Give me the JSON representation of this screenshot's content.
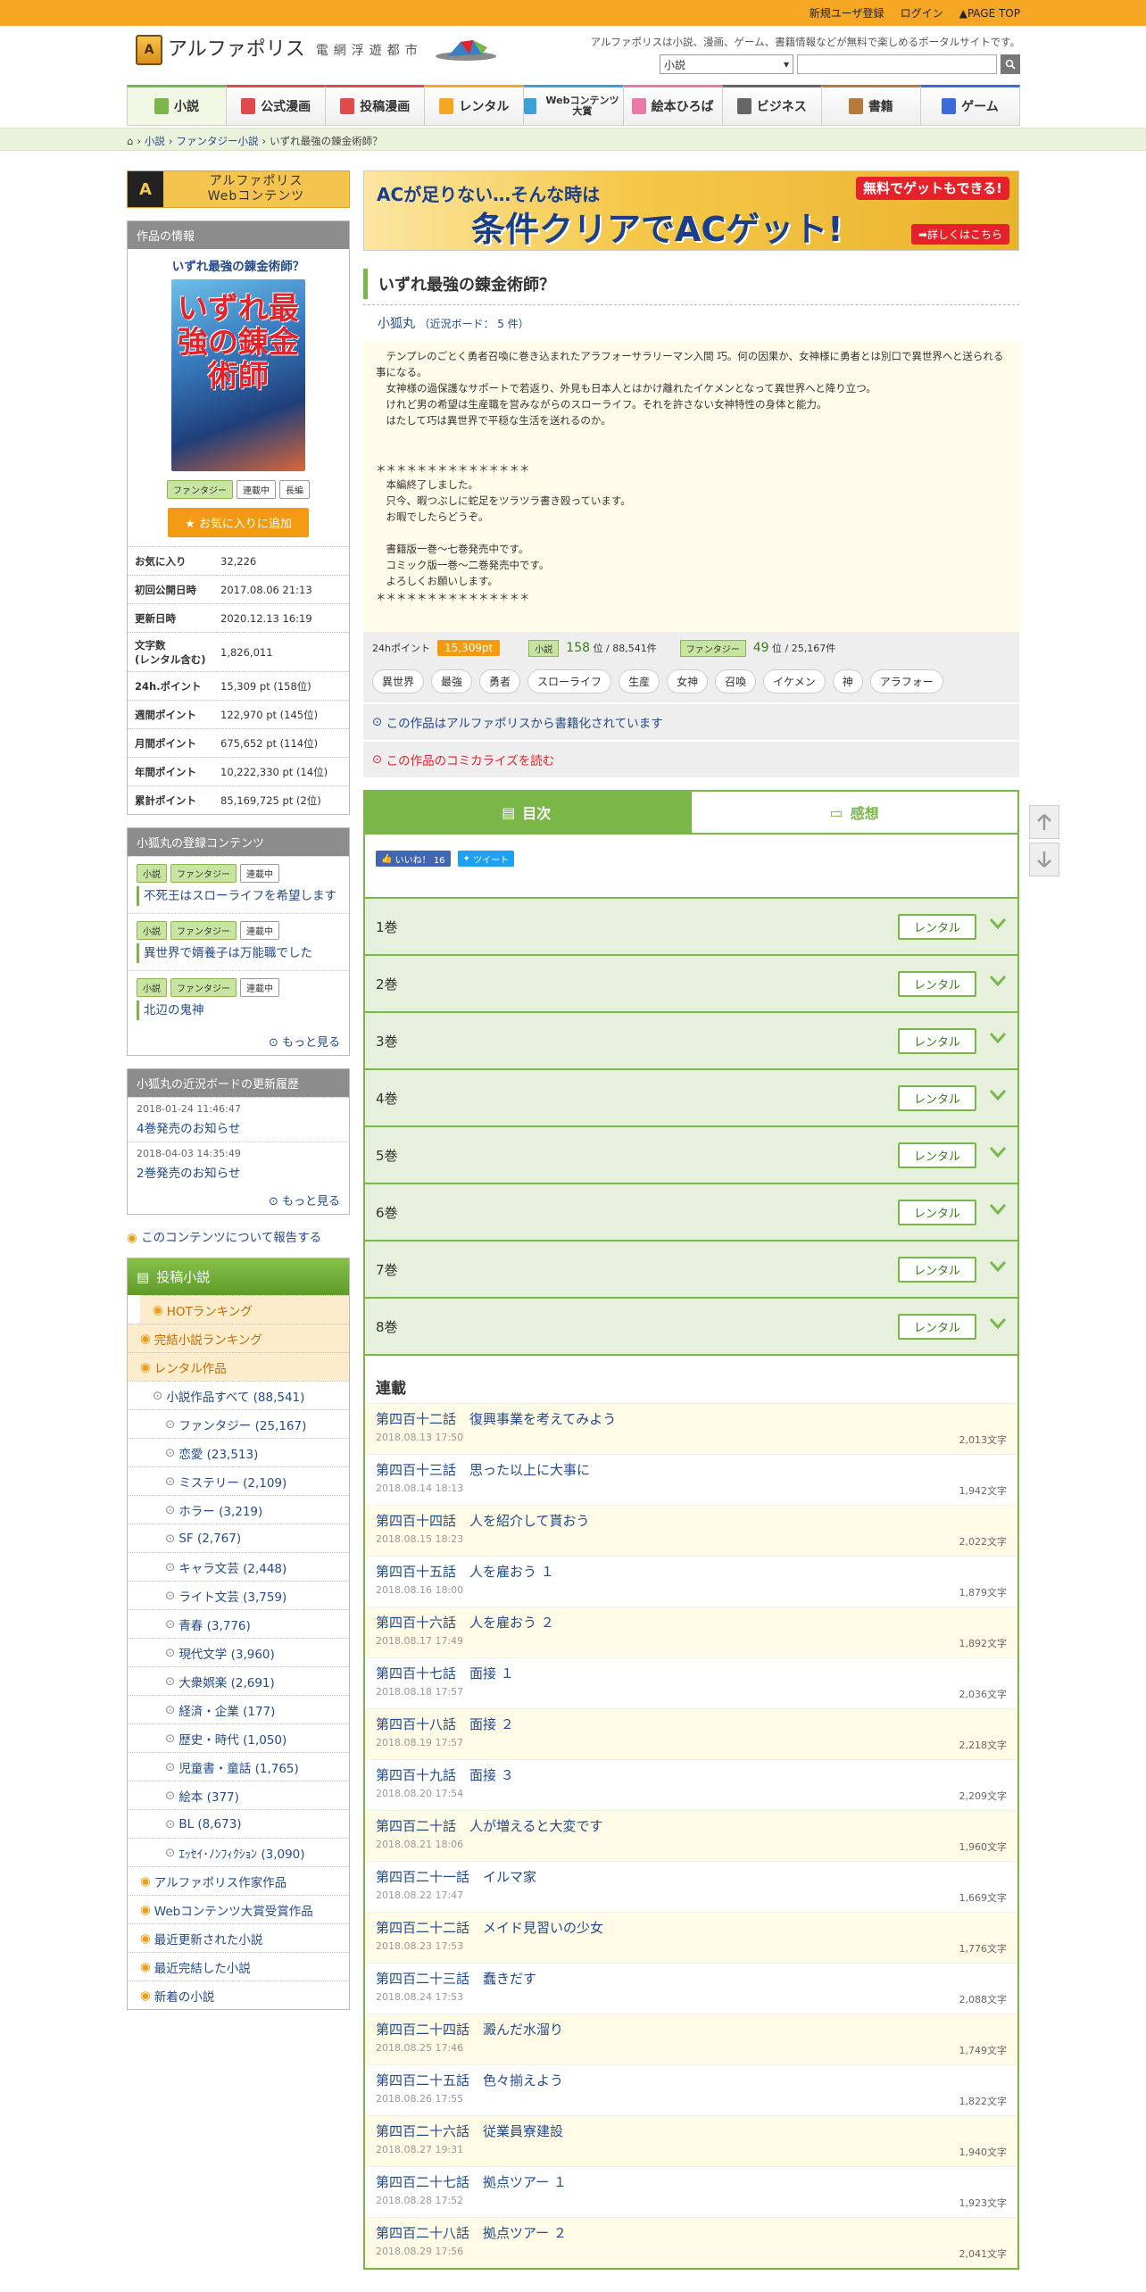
{
  "topbar": {
    "signup": "新規ユーザ登録",
    "login": "ログイン",
    "pagetop": "PAGE TOP"
  },
  "header": {
    "site_name": "アルファポリス",
    "site_sub": "電網浮遊都市",
    "tagline": "アルファポリスは小説、漫画、ゲーム、書籍情報などが無料で楽しめるポータルサイトです。",
    "search_category": "小説",
    "search_placeholder": ""
  },
  "nav": [
    {
      "label": "小説",
      "color": "#7ab648"
    },
    {
      "label": "公式漫画",
      "color": "#e24a4a"
    },
    {
      "label": "投稿漫画",
      "color": "#e24a4a"
    },
    {
      "label": "レンタル",
      "color": "#f5a623"
    },
    {
      "label": "Webコンテンツ大賞",
      "color": "#3aa0d8"
    },
    {
      "label": "絵本ひろば",
      "color": "#e87aa8"
    },
    {
      "label": "ビジネス",
      "color": "#666"
    },
    {
      "label": "書籍",
      "color": "#b87a3a"
    },
    {
      "label": "ゲーム",
      "color": "#3a6bd8"
    }
  ],
  "breadcrumb": [
    "小説",
    "ファンタジー小説",
    "いずれ最強の錬金術師？"
  ],
  "sidebar": {
    "webcon_label1": "アルファポリス",
    "webcon_label2": "Webコンテンツ",
    "work_info_header": "作品の情報",
    "work_title": "いずれ最強の錬金術師？",
    "cover_title": "いずれ最強の錬金術師",
    "tags": [
      "ファンタジー",
      "連載中",
      "長編"
    ],
    "fav_button": "お気に入りに追加",
    "stats": [
      {
        "k": "お気に入り",
        "v": "32,226"
      },
      {
        "k": "初回公開日時",
        "v": "2017.08.06 21:13"
      },
      {
        "k": "更新日時",
        "v": "2020.12.13 16:19"
      },
      {
        "k": "文字数\n(レンタル含む)",
        "v": "1,826,011"
      },
      {
        "k": "24h.ポイント",
        "v": "15,309 pt (158位)"
      },
      {
        "k": "週間ポイント",
        "v": "122,970 pt (145位)"
      },
      {
        "k": "月間ポイント",
        "v": "675,652 pt (114位)"
      },
      {
        "k": "年間ポイント",
        "v": "10,222,330 pt (14位)"
      },
      {
        "k": "累計ポイント",
        "v": "85,169,725 pt (2位)"
      }
    ],
    "author_works_header": "小狐丸の登録コンテンツ",
    "author_works": [
      {
        "tags": [
          "小説",
          "ファンタジー",
          "連載中"
        ],
        "title": "不死王はスローライフを希望します"
      },
      {
        "tags": [
          "小説",
          "ファンタジー",
          "連載中"
        ],
        "title": "異世界で婿養子は万能職でした"
      },
      {
        "tags": [
          "小説",
          "ファンタジー",
          "連載中"
        ],
        "title": "北辺の鬼神"
      }
    ],
    "more": "もっと見る",
    "board_header": "小狐丸の近況ボードの更新履歴",
    "board": [
      {
        "date": "2018-01-24 11:46:47",
        "title": "4巻発売のお知らせ"
      },
      {
        "date": "2018-04-03 14:35:49",
        "title": "2巻発売のお知らせ"
      }
    ],
    "report": "このコンテンツについて報告する",
    "cat_header": "投稿小説",
    "categories": [
      {
        "label": "HOTランキング",
        "style": "o",
        "indent": 0
      },
      {
        "label": "完結小説ランキング",
        "style": "o",
        "indent": 0
      },
      {
        "label": "レンタル作品",
        "style": "o",
        "indent": 0
      },
      {
        "label": "小説作品すべて (88,541)",
        "style": "",
        "indent": 1
      },
      {
        "label": "ファンタジー (25,167)",
        "style": "",
        "indent": 2
      },
      {
        "label": "恋愛 (23,513)",
        "style": "",
        "indent": 2
      },
      {
        "label": "ミステリー (2,109)",
        "style": "",
        "indent": 2
      },
      {
        "label": "ホラー (3,219)",
        "style": "",
        "indent": 2
      },
      {
        "label": "SF (2,767)",
        "style": "",
        "indent": 2
      },
      {
        "label": "キャラ文芸 (2,448)",
        "style": "",
        "indent": 2
      },
      {
        "label": "ライト文芸 (3,759)",
        "style": "",
        "indent": 2
      },
      {
        "label": "青春 (3,776)",
        "style": "",
        "indent": 2
      },
      {
        "label": "現代文学 (3,960)",
        "style": "",
        "indent": 2
      },
      {
        "label": "大衆娯楽 (2,691)",
        "style": "",
        "indent": 2
      },
      {
        "label": "経済・企業 (177)",
        "style": "",
        "indent": 2
      },
      {
        "label": "歴史・時代 (1,050)",
        "style": "",
        "indent": 2
      },
      {
        "label": "児童書・童話 (1,765)",
        "style": "",
        "indent": 2
      },
      {
        "label": "絵本 (377)",
        "style": "",
        "indent": 2
      },
      {
        "label": "BL (8,673)",
        "style": "",
        "indent": 2
      },
      {
        "label": "ｴｯｾｲ･ﾉﾝﾌｨｸｼｮﾝ (3,090)",
        "style": "",
        "indent": 2
      },
      {
        "label": "アルファポリス作家作品",
        "style": "",
        "indent": 0
      },
      {
        "label": "Webコンテンツ大賞受賞作品",
        "style": "",
        "indent": 0
      },
      {
        "label": "最近更新された小説",
        "style": "",
        "indent": 0
      },
      {
        "label": "最近完結した小説",
        "style": "",
        "indent": 0
      },
      {
        "label": "新着の小説",
        "style": "",
        "indent": 0
      }
    ]
  },
  "main": {
    "banner": {
      "line1": "ACが足りない…そんな時は",
      "line2": "条件クリアでACゲット!",
      "badge": "無料でゲットもできる!",
      "detail": "➡詳しくはこちら"
    },
    "title": "いずれ最強の錬金術師？",
    "author": "小狐丸",
    "board_count": "（近況ボード： 5 件）",
    "intro": "　テンプレのごとく勇者召喚に巻き込まれたアラフォーサラリーマン入間 巧。何の因果か、女神様に勇者とは別口で異世界へと送られる事になる。\n　女神様の過保護なサポートで若返り、外見も日本人とはかけ離れたイケメンとなって異世界へと降り立つ。\n　けれど男の希望は生産職を営みながらのスローライフ。それを許さない女神特性の身体と能力。\n　はたして巧は異世界で平穏な生活を送れるのか。\n\n\n＊＊＊＊＊＊＊＊＊＊＊＊＊＊＊\n　本編終了しました。\n　只今、暇つぶしに蛇足をツラツラ書き殴っています。\n　お暇でしたらどうぞ。\n\n　書籍版一巻〜七巻発売中です。\n　コミック版一巻〜二巻発売中です。\n　よろしくお願いします。\n＊＊＊＊＊＊＊＊＊＊＊＊＊＊＊",
    "points_label": "24hポイント",
    "points_value": "15,309pt",
    "rank1_tag": "小説",
    "rank1": "158",
    "rank1_total": "位 / 88,541件",
    "rank2_tag": "ファンタジー",
    "rank2": "49",
    "rank2_total": "位 / 25,167件",
    "keywords": [
      "異世界",
      "最強",
      "勇者",
      "スローライフ",
      "生産",
      "女神",
      "召喚",
      "イケメン",
      "神",
      "アラフォー"
    ],
    "book_link": "この作品はアルファポリスから書籍化されています",
    "comic_link": "この作品のコミカライズを読む",
    "tab_toc": "目次",
    "tab_reviews": "感想",
    "like_label": "いいね！ 16",
    "tweet_label": "ツイート",
    "volumes": [
      "1巻",
      "2巻",
      "3巻",
      "4巻",
      "5巻",
      "6巻",
      "7巻",
      "8巻"
    ],
    "rental_label": "レンタル",
    "serial_header": "連載",
    "episodes": [
      {
        "title": "第四百十二話　復興事業を考えてみよう",
        "date": "2018.08.13 17:50",
        "chars": "2,013文字"
      },
      {
        "title": "第四百十三話　思った以上に大事に",
        "date": "2018.08.14 18:13",
        "chars": "1,942文字"
      },
      {
        "title": "第四百十四話　人を紹介して貰おう",
        "date": "2018.08.15 18:23",
        "chars": "2,022文字"
      },
      {
        "title": "第四百十五話　人を雇おう １",
        "date": "2018.08.16 18:00",
        "chars": "1,879文字"
      },
      {
        "title": "第四百十六話　人を雇おう ２",
        "date": "2018.08.17 17:49",
        "chars": "1,892文字"
      },
      {
        "title": "第四百十七話　面接 １",
        "date": "2018.08.18 17:57",
        "chars": "2,036文字"
      },
      {
        "title": "第四百十八話　面接 ２",
        "date": "2018.08.19 17:57",
        "chars": "2,218文字"
      },
      {
        "title": "第四百十九話　面接 ３",
        "date": "2018.08.20 17:54",
        "chars": "2,209文字"
      },
      {
        "title": "第四百二十話　人が増えると大変です",
        "date": "2018.08.21 18:06",
        "chars": "1,960文字"
      },
      {
        "title": "第四百二十一話　イルマ家",
        "date": "2018.08.22 17:47",
        "chars": "1,669文字"
      },
      {
        "title": "第四百二十二話　メイド見習いの少女",
        "date": "2018.08.23 17:53",
        "chars": "1,776文字"
      },
      {
        "title": "第四百二十三話　蠢きだす",
        "date": "2018.08.24 17:53",
        "chars": "2,088文字"
      },
      {
        "title": "第四百二十四話　澱んだ水溜り",
        "date": "2018.08.25 17:46",
        "chars": "1,749文字"
      },
      {
        "title": "第四百二十五話　色々揃えよう",
        "date": "2018.08.26 17:55",
        "chars": "1,822文字"
      },
      {
        "title": "第四百二十六話　従業員寮建設",
        "date": "2018.08.27 19:31",
        "chars": "1,940文字"
      },
      {
        "title": "第四百二十七話　拠点ツアー １",
        "date": "2018.08.28 17:52",
        "chars": "1,923文字"
      },
      {
        "title": "第四百二十八話　拠点ツアー ２",
        "date": "2018.08.29 17:56",
        "chars": "2,041文字"
      }
    ]
  }
}
